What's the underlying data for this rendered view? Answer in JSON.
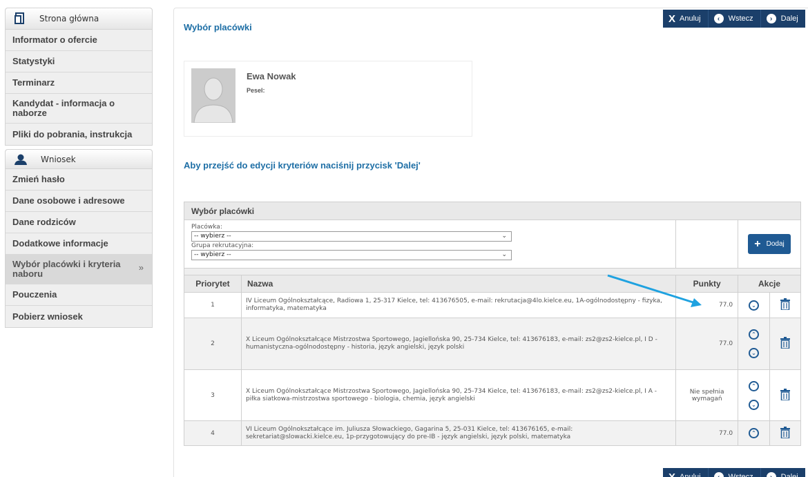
{
  "sidebar": {
    "home": "Strona główna",
    "top_items": [
      "Informator o ofercie",
      "Statystyki",
      "Terminarz",
      "Kandydat - informacja o naborze",
      "Pliki do pobrania, instrukcja"
    ],
    "wniosek_header": "Wniosek",
    "wniosek_items": [
      "Zmień hasło",
      "Dane osobowe i adresowe",
      "Dane rodziców",
      "Dodatkowe informacje",
      "Wybór placówki i kryteria naboru",
      "Pouczenia",
      "Pobierz wniosek"
    ],
    "active_arrow": "»"
  },
  "toolbar": {
    "cancel": "Anuluj",
    "back": "Wstecz",
    "next": "Dalej"
  },
  "page": {
    "title": "Wybór placówki",
    "person_name": "Ewa Nowak",
    "pesel_label": "Pesel:",
    "hint": "Aby przejść do edycji kryteriów naciśnij przycisk 'Dalej'"
  },
  "selector": {
    "caption": "Wybór placówki",
    "placowka_label": "Placówka:",
    "placowka_value": "-- wybierz --",
    "grupa_label": "Grupa rekrutacyjna:",
    "grupa_value": "-- wybierz --",
    "add_label": "Dodaj"
  },
  "table": {
    "headers": {
      "priority": "Priorytet",
      "name": "Nazwa",
      "points": "Punkty",
      "actions": "Akcje"
    },
    "rows": [
      {
        "priority": "1",
        "name": "IV Liceum Ogólnokształcące, Radiowa 1, 25-317 Kielce, tel: 413676505, e-mail: rekrutacja@4lo.kielce.eu, 1A-ogólnodostępny - fizyka, informatyka, matematyka",
        "points": "77.0"
      },
      {
        "priority": "2",
        "name": "X Liceum Ogólnokształcące Mistrzostwa Sportowego, Jagiellońska 90, 25-734 Kielce, tel: 413676183, e-mail: zs2@zs2-kielce.pl, I D - humanistyczna-ogólnodostępny - historia, język angielski, język polski",
        "points": "77.0"
      },
      {
        "priority": "3",
        "name": "X Liceum Ogólnokształcące Mistrzostwa Sportowego, Jagiellońska 90, 25-734 Kielce, tel: 413676183, e-mail: zs2@zs2-kielce.pl, I A - piłka siatkowa-mistrzostwa sportowego - biologia, chemia, język angielski",
        "points": "Nie spełnia wymagań"
      },
      {
        "priority": "4",
        "name": "VI Liceum Ogólnokształcące im. Juliusza Słowackiego, Gagarina 5, 25-031 Kielce, tel: 413676165, e-mail: sekretariat@slowacki.kielce.eu, 1p-przygotowujący do pre-IB - język angielski, język polski, matematyka",
        "points": "77.0"
      }
    ]
  },
  "colors": {
    "accent": "#1d6ea5",
    "toolbar": "#1b3f6a",
    "button": "#1f5a93",
    "annotation": "#1fa2e0"
  }
}
